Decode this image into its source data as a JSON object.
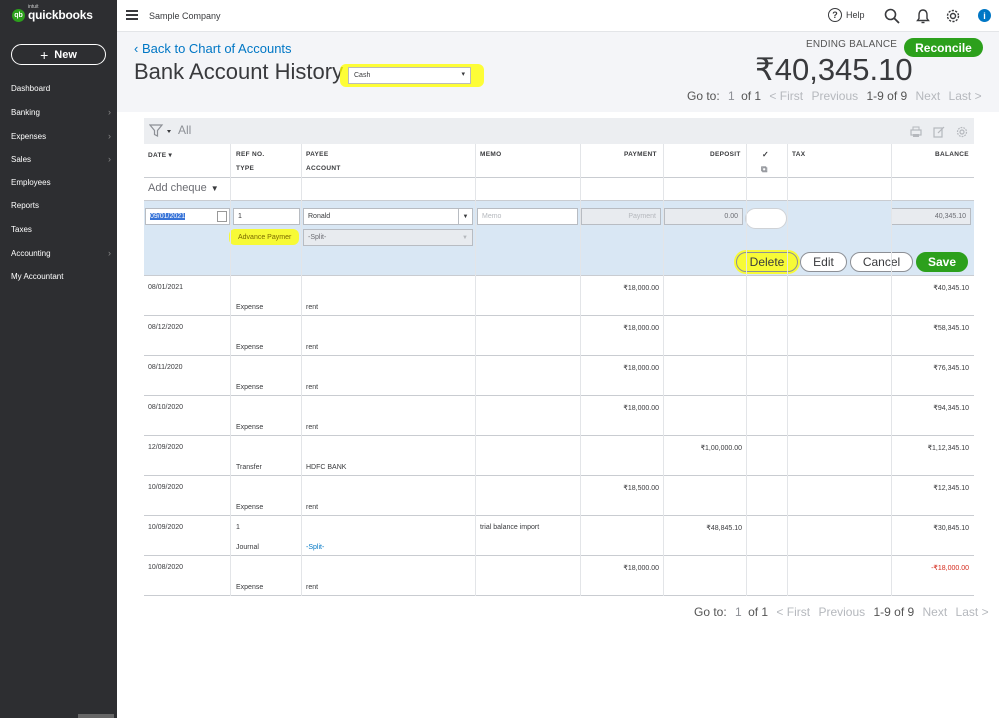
{
  "app": {
    "brand_small": "intuit",
    "brand": "quickbooks",
    "company": "Sample Company",
    "help": "Help"
  },
  "sidebar": {
    "new_label": "New",
    "items": [
      {
        "label": "Dashboard",
        "chevron": false
      },
      {
        "label": "Banking",
        "chevron": true
      },
      {
        "label": "Expenses",
        "chevron": true
      },
      {
        "label": "Sales",
        "chevron": true
      },
      {
        "label": "Employees",
        "chevron": false
      },
      {
        "label": "Reports",
        "chevron": false
      },
      {
        "label": "Taxes",
        "chevron": false
      },
      {
        "label": "Accounting",
        "chevron": true
      },
      {
        "label": "My Accountant",
        "chevron": false
      }
    ]
  },
  "header": {
    "back_link": "Back to Chart of Accounts",
    "title": "Bank Account History",
    "account": "Cash",
    "ending_balance_label": "ENDING BALANCE",
    "ending_balance": "₹40,345.10",
    "reconcile": "Reconcile"
  },
  "pager": {
    "goto": "Go to:",
    "page": "1",
    "of": "of 1",
    "first": "< First",
    "previous": "Previous",
    "range": "1-9 of 9",
    "next": "Next",
    "last": "Last >"
  },
  "grid": {
    "filter_all": "All",
    "columns": {
      "date": "DATE",
      "ref_no": "REF NO.",
      "type": "TYPE",
      "payee": "PAYEE",
      "account": "ACCOUNT",
      "memo": "MEMO",
      "payment": "PAYMENT",
      "deposit": "DEPOSIT",
      "cleared": "✓",
      "tax": "TAX",
      "balance": "BALANCE"
    },
    "add_cheque": "Add cheque",
    "edit_row": {
      "date": "09/01/2021",
      "ref_no": "1",
      "payee": "Ronald",
      "memo_placeholder": "Memo",
      "payment_placeholder": "Payment",
      "deposit": "0.00",
      "balance": "40,345.10",
      "type": "Advance Paymer",
      "account": "-Split-",
      "buttons": {
        "delete": "Delete",
        "edit": "Edit",
        "cancel": "Cancel",
        "save": "Save"
      }
    },
    "rows": [
      {
        "date": "08/01/2021",
        "ref": "",
        "type": "Expense",
        "payee": "",
        "account": "rent",
        "memo": "",
        "payment": "₹18,000.00",
        "deposit": "",
        "balance": "₹40,345.10"
      },
      {
        "date": "08/12/2020",
        "ref": "",
        "type": "Expense",
        "payee": "",
        "account": "rent",
        "memo": "",
        "payment": "₹18,000.00",
        "deposit": "",
        "balance": "₹58,345.10"
      },
      {
        "date": "08/11/2020",
        "ref": "",
        "type": "Expense",
        "payee": "",
        "account": "rent",
        "memo": "",
        "payment": "₹18,000.00",
        "deposit": "",
        "balance": "₹76,345.10"
      },
      {
        "date": "08/10/2020",
        "ref": "",
        "type": "Expense",
        "payee": "",
        "account": "rent",
        "memo": "",
        "payment": "₹18,000.00",
        "deposit": "",
        "balance": "₹94,345.10"
      },
      {
        "date": "12/09/2020",
        "ref": "",
        "type": "Transfer",
        "payee": "",
        "account": "HDFC BANK",
        "memo": "",
        "payment": "",
        "deposit": "₹1,00,000.00",
        "balance": "₹1,12,345.10"
      },
      {
        "date": "10/09/2020",
        "ref": "",
        "type": "Expense",
        "payee": "",
        "account": "rent",
        "memo": "",
        "payment": "₹18,500.00",
        "deposit": "",
        "balance": "₹12,345.10"
      },
      {
        "date": "10/09/2020",
        "ref": "1",
        "type": "Journal",
        "payee": "",
        "account": "-Split-",
        "memo": "trial balance import",
        "payment": "",
        "deposit": "₹48,845.10",
        "balance": "₹30,845.10",
        "account_link": true
      },
      {
        "date": "10/08/2020",
        "ref": "",
        "type": "Expense",
        "payee": "",
        "account": "rent",
        "memo": "",
        "payment": "₹18,000.00",
        "deposit": "",
        "balance": "-₹18,000.00",
        "negative": true
      }
    ]
  },
  "colors": {
    "brand_green": "#2ca01c",
    "link_blue": "#0077c5",
    "sidebar_bg": "#2d2e31",
    "highlight": "#ffff00",
    "negative": "#d52b1e"
  }
}
